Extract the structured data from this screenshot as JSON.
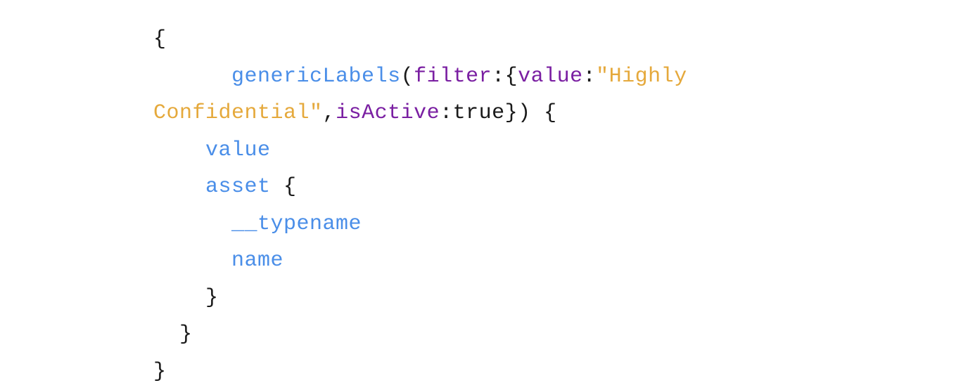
{
  "colors": {
    "default": "#1a1a1a",
    "blue": "#4a8ee8",
    "purple": "#7a1fa2",
    "orange": "#e5a93c",
    "background": "#ffffff"
  },
  "code": {
    "t0": "{",
    "t1": "      ",
    "t2": "genericLabels",
    "t3": "(",
    "t4": "filter",
    "t5": ":{",
    "t6": "value",
    "t7": ":",
    "t8": "\"Highly ",
    "t9": "Confidential\"",
    "t10": ",",
    "t11": "isActive",
    "t12": ":",
    "t13": "true",
    "t14": "}) {",
    "t15": "    ",
    "t16": "value",
    "t17": "    ",
    "t18": "asset",
    "t19": " {",
    "t20": "      ",
    "t21": "__typename",
    "t22": "      ",
    "t23": "name",
    "t24": "    }",
    "t25": "  }",
    "t26": "}"
  }
}
